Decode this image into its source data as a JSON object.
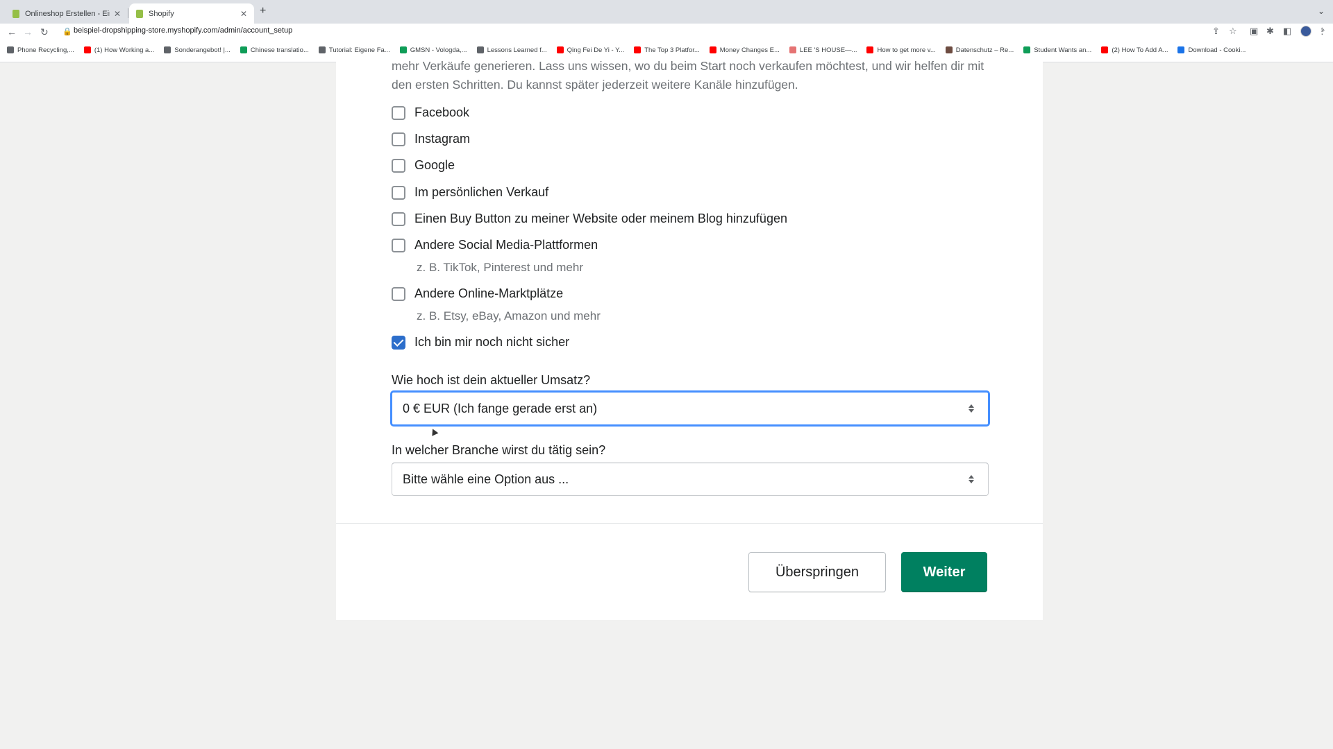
{
  "browser": {
    "tabs": [
      {
        "title": "Onlineshop Erstellen - Einfach",
        "active": false
      },
      {
        "title": "Shopify",
        "active": true
      }
    ],
    "new_tab": "+",
    "address": {
      "url": "beispiel-dropshipping-store.myshopify.com/admin/account_setup"
    },
    "bookmarks": [
      {
        "label": "Phone Recycling,...",
        "color": "#5f6368"
      },
      {
        "label": "(1) How Working a...",
        "color": "#ff0000"
      },
      {
        "label": "Sonderangebot! |...",
        "color": "#5f6368"
      },
      {
        "label": "Chinese translatio...",
        "color": "#0f9d58"
      },
      {
        "label": "Tutorial: Eigene Fa...",
        "color": "#5f6368"
      },
      {
        "label": "GMSN - Vologda,...",
        "color": "#0f9d58"
      },
      {
        "label": "Lessons Learned f...",
        "color": "#5f6368"
      },
      {
        "label": "Qing Fei De Yi - Y...",
        "color": "#ff0000"
      },
      {
        "label": "The Top 3 Platfor...",
        "color": "#ff0000"
      },
      {
        "label": "Money Changes E...",
        "color": "#ff0000"
      },
      {
        "label": "LEE 'S HOUSE—...",
        "color": "#e57373"
      },
      {
        "label": "How to get more v...",
        "color": "#ff0000"
      },
      {
        "label": "Datenschutz – Re...",
        "color": "#6d4c41"
      },
      {
        "label": "Student Wants an...",
        "color": "#0f9d58"
      },
      {
        "label": "(2) How To Add A...",
        "color": "#ff0000"
      },
      {
        "label": "Download - Cooki...",
        "color": "#1a73e8"
      }
    ],
    "bookmarks_more": "»"
  },
  "page": {
    "intro": "mehr Verkäufe generieren. Lass uns wissen, wo du beim Start noch verkaufen möchtest, und wir helfen dir mit den ersten Schritten. Du kannst später jederzeit weitere Kanäle hinzufügen.",
    "options": [
      {
        "label": "Facebook",
        "checked": false
      },
      {
        "label": "Instagram",
        "checked": false
      },
      {
        "label": "Google",
        "checked": false
      },
      {
        "label": "Im persönlichen Verkauf",
        "checked": false
      },
      {
        "label": "Einen Buy Button zu meiner Website oder meinem Blog hinzufügen",
        "checked": false
      },
      {
        "label": "Andere Social Media-Plattformen",
        "checked": false,
        "help": "z. B. TikTok, Pinterest und mehr"
      },
      {
        "label": "Andere Online-Marktplätze",
        "checked": false,
        "help": "z. B. Etsy, eBay, Amazon und mehr"
      },
      {
        "label": "Ich bin mir noch nicht sicher",
        "checked": true
      }
    ],
    "revenue": {
      "label": "Wie hoch ist dein aktueller Umsatz?",
      "value": "0 € EUR (Ich fange gerade erst an)"
    },
    "industry": {
      "label": "In welcher Branche wirst du tätig sein?",
      "value": "Bitte wähle eine Option aus ..."
    },
    "buttons": {
      "skip": "Überspringen",
      "next": "Weiter"
    }
  },
  "colors": {
    "primary": "#008060",
    "checkbox_checked": "#2c6ecb",
    "focus": "#458fff"
  }
}
